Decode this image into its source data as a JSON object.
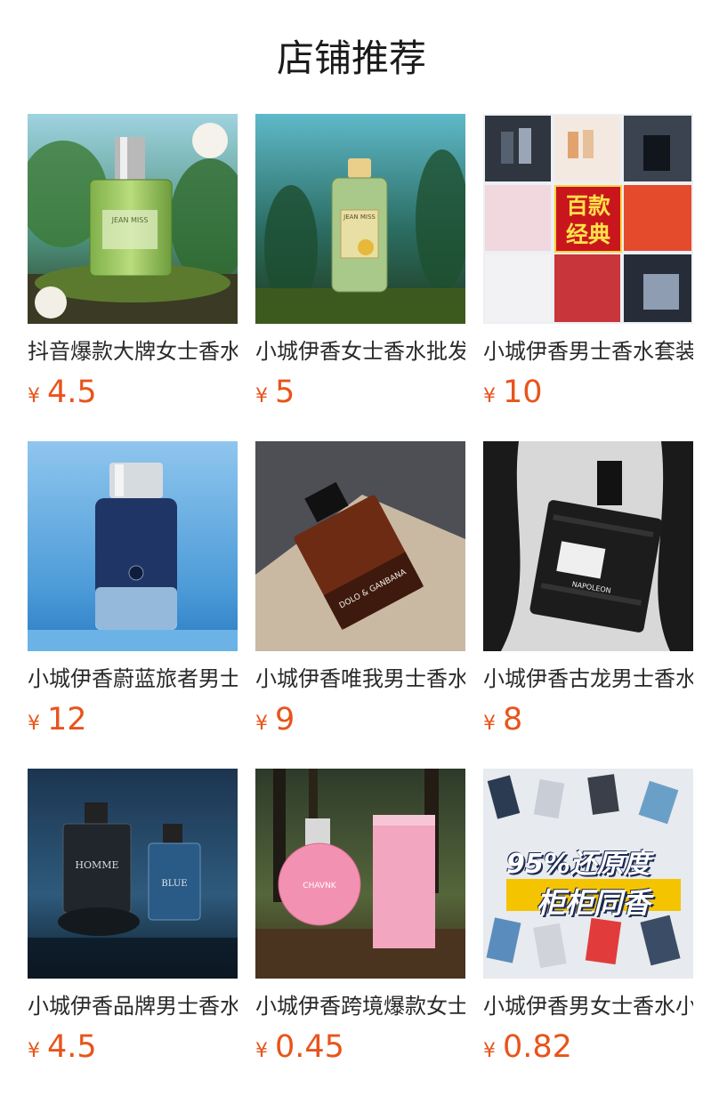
{
  "section": {
    "title": "店铺推荐"
  },
  "currency_symbol": "¥",
  "accent_color": "#e8541b",
  "products": [
    {
      "name": "抖音爆款大牌女士香水",
      "price": "4.5",
      "image_icon": "green-perfume-bottle-icon",
      "bottle_label": "JEAN MISS"
    },
    {
      "name": "小城伊香女士香水批发",
      "price": "5",
      "image_icon": "green-perfume-bottle-icon",
      "bottle_label": "JEAN MISS"
    },
    {
      "name": "小城伊香男士香水套装",
      "price": "10",
      "image_icon": "perfume-gift-set-collage-icon",
      "overlay_line1": "百款",
      "overlay_line2": "经典"
    },
    {
      "name": "小城伊香蔚蓝旅者男士香水",
      "price": "12",
      "image_icon": "blue-perfume-bottle-icon"
    },
    {
      "name": "小城伊香唯我男士香水",
      "price": "9",
      "image_icon": "brown-perfume-bottle-icon",
      "bottle_label": "DOLO & GANBANA"
    },
    {
      "name": "小城伊香古龙男士香水",
      "price": "8",
      "image_icon": "black-perfume-bottle-icon",
      "bottle_label": "NAPOLEON"
    },
    {
      "name": "小城伊香品牌男士香水",
      "price": "4.5",
      "image_icon": "homme-perfume-bottles-icon",
      "bottle_label": "HOMME",
      "bottle_label_2": "BLUE"
    },
    {
      "name": "小城伊香跨境爆款女士香水",
      "price": "0.45",
      "image_icon": "pink-perfume-bottle-icon",
      "bottle_label": "CHAVNK"
    },
    {
      "name": "小城伊香男女士香水小样",
      "price": "0.82",
      "image_icon": "sample-perfume-collage-icon",
      "overlay_line1": "95%还原度",
      "overlay_line2": "柜柜同香"
    }
  ]
}
